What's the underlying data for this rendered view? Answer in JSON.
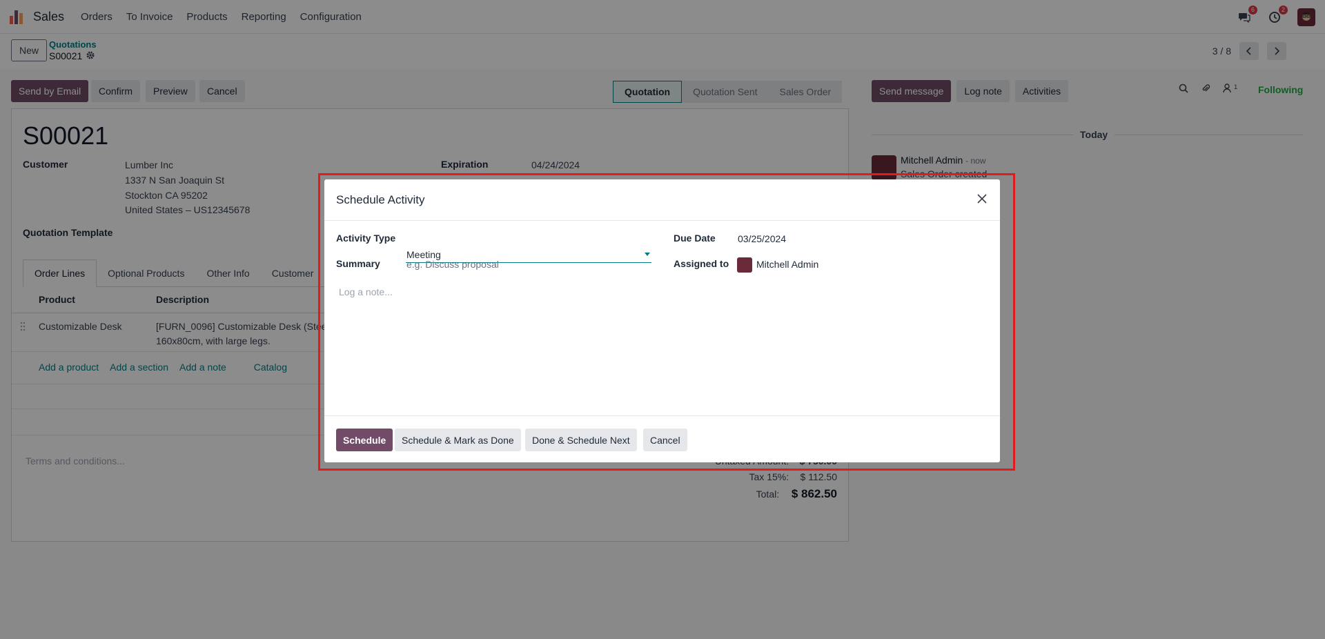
{
  "nav": {
    "app_name": "Sales",
    "menu": [
      "Orders",
      "To Invoice",
      "Products",
      "Reporting",
      "Configuration"
    ],
    "messages_badge": "6",
    "activities_badge": "2"
  },
  "control": {
    "new_label": "New",
    "breadcrumb_parent": "Quotations",
    "breadcrumb_current": "S00021",
    "pager": "3 / 8"
  },
  "actions": {
    "send_by_email": "Send by Email",
    "confirm": "Confirm",
    "preview": "Preview",
    "cancel": "Cancel"
  },
  "status": {
    "stages": [
      "Quotation",
      "Quotation Sent",
      "Sales Order"
    ],
    "active": "Quotation"
  },
  "form": {
    "name": "S00021",
    "customer_label": "Customer",
    "customer_lines": [
      "Lumber Inc",
      "1337 N San Joaquin St",
      "Stockton CA 95202",
      "United States – US12345678"
    ],
    "expiration_label": "Expiration",
    "expiration_value": "04/24/2024",
    "template_label": "Quotation Template",
    "tabs": [
      "Order Lines",
      "Optional Products",
      "Other Info",
      "Customer"
    ],
    "columns": {
      "product": "Product",
      "description": "Description"
    },
    "row": {
      "product": "Customizable Desk",
      "description_line1": "[FURN_0096] Customizable Desk (Stee",
      "description_line2": "160x80cm, with large legs."
    },
    "add_links": [
      "Add a product",
      "Add a section",
      "Add a note",
      "Catalog"
    ],
    "terms_placeholder": "Terms and conditions...",
    "untaxed_label": "Untaxed Amount:",
    "untaxed_value": "$ 750.00",
    "tax_label": "Tax 15%:",
    "tax_value": "$ 112.50",
    "total_label": "Total:",
    "total_value": "$ 862.50"
  },
  "chatter": {
    "send_message": "Send message",
    "log_note": "Log note",
    "activities": "Activities",
    "followers_count": "1",
    "following": "Following",
    "today": "Today",
    "author": "Mitchell Admin",
    "time": "- now",
    "body": "Sales Order created"
  },
  "modal": {
    "title": "Schedule Activity",
    "activity_type_label": "Activity Type",
    "activity_type_value": "Meeting",
    "summary_label": "Summary",
    "summary_placeholder": "e.g. Discuss proposal",
    "due_date_label": "Due Date",
    "due_date_value": "03/25/2024",
    "assigned_label": "Assigned to",
    "assigned_value": "Mitchell Admin",
    "note_placeholder": "Log a note...",
    "buttons": {
      "schedule": "Schedule",
      "schedule_done": "Schedule & Mark as Done",
      "done_next": "Done & Schedule Next",
      "cancel": "Cancel"
    }
  },
  "colors": {
    "primary": "#714b67",
    "link": "#017e84",
    "highlight": "#e21c1c",
    "following": "#28a745"
  }
}
